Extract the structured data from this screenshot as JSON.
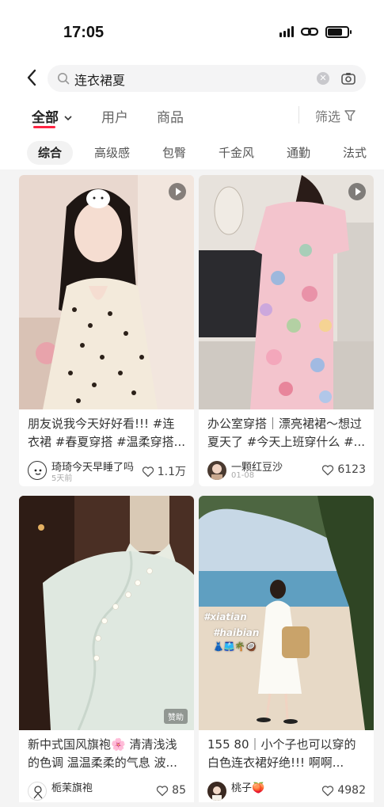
{
  "status_bar": {
    "time": "17:05",
    "battery_level": 0.75
  },
  "search": {
    "query": "连衣裙夏",
    "icons": [
      "back-icon",
      "search-icon",
      "clear-icon",
      "camera-icon"
    ]
  },
  "tabs": [
    {
      "label": "全部",
      "active": true
    },
    {
      "label": "用户",
      "active": false
    },
    {
      "label": "商品",
      "active": false
    }
  ],
  "filter_label": "筛选",
  "chips": [
    "综合",
    "高级感",
    "包臀",
    "千金风",
    "通勤",
    "法式"
  ],
  "colors": {
    "accent": "#ff2442",
    "feed_bg": "#f4f4f4"
  },
  "posts": [
    {
      "title": "朋友说我今天好好看!!! #连衣裙 #春夏穿搭 #温柔穿搭...",
      "author": "琦琦今天早睡了吗",
      "date": "5天前",
      "likes": "1.1万",
      "video": true
    },
    {
      "title": "办公室穿搭｜漂亮裙裙～想过夏天了 #今天上班穿什么 #...",
      "author": "一颗红豆沙",
      "date": "01-08",
      "likes": "6123",
      "video": true
    },
    {
      "title": "新中式国风旗袍🌸 清清浅浅的色调 温温柔柔的气息 波...",
      "author": "栀茉旗袍",
      "date": "",
      "likes": "85",
      "ad_label": "赞助",
      "video": false
    },
    {
      "title": "155 80｜小个子也可以穿的白色连衣裙好绝!!! 啊啊...",
      "author": "桃子🍑",
      "date": "",
      "likes": "4982",
      "overlay": [
        "#xiatian",
        "#haibian",
        "👗🩳🌴🥥"
      ],
      "video": false
    }
  ]
}
